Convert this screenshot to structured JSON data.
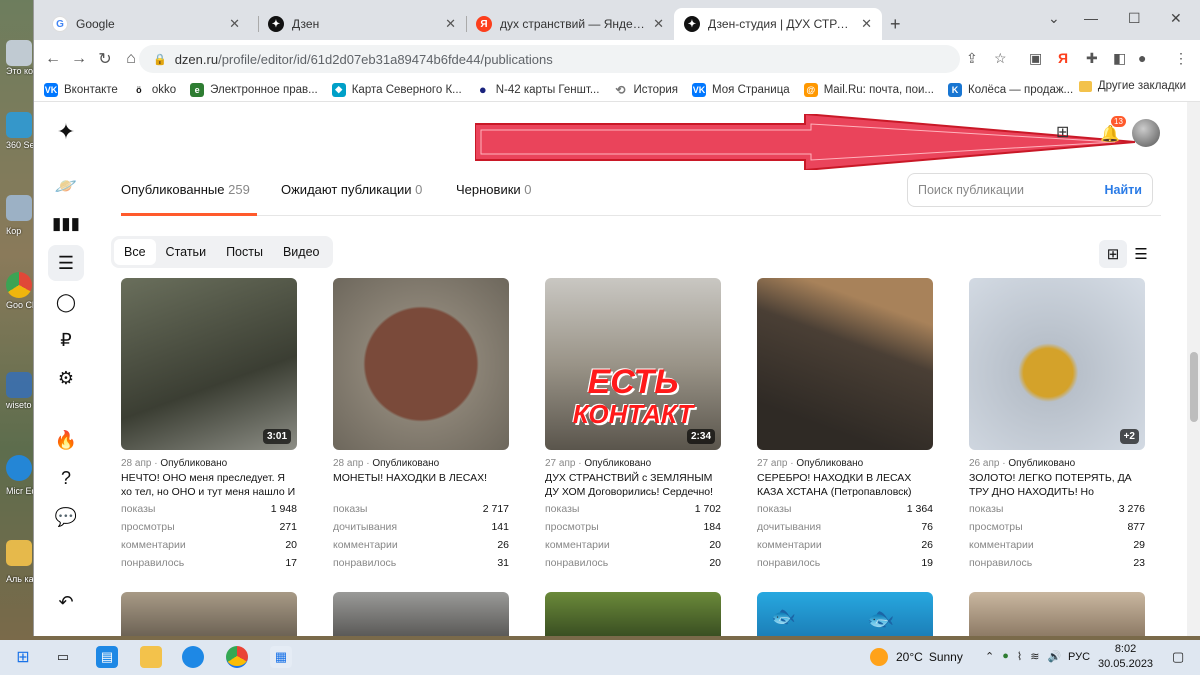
{
  "desktop": {
    "labels": [
      "Это комп",
      "360 Sec",
      "Кор",
      "Goo Chr",
      "wiseto",
      "Micr Ed",
      "Аль кам"
    ]
  },
  "browser": {
    "tabs": [
      {
        "title": "Google",
        "favicon": "G",
        "color": "#4285f4"
      },
      {
        "title": "Дзен",
        "favicon": "✦",
        "color": "#111111"
      },
      {
        "title": "дух странствий — Яндекс: нашё",
        "favicon": "Я",
        "color": "#fc3f1d"
      },
      {
        "title": "Дзен-студия | ДУХ СТРАНСТВИ",
        "favicon": "✦",
        "color": "#111111",
        "active": true
      }
    ],
    "url_host": "dzen.ru",
    "url_path": "/profile/editor/id/61d2d07eb31a89474b6fde44/publications",
    "bookmarks": [
      {
        "label": "Вконтакте",
        "icon": "VK",
        "color": "#0077ff"
      },
      {
        "label": "okko",
        "icon": "ö",
        "color": "#111111"
      },
      {
        "label": "Электронное прав...",
        "icon": "e",
        "color": "#2e7d32"
      },
      {
        "label": "Карта Северного К...",
        "icon": "◆",
        "color": "#00a0c8"
      },
      {
        "label": "N-42 карты Геншт...",
        "icon": "●",
        "color": "#1a237e"
      },
      {
        "label": "История",
        "icon": "⟲",
        "color": "#777777"
      },
      {
        "label": "Моя Страница",
        "icon": "VK",
        "color": "#0077ff"
      },
      {
        "label": "Mail.Ru: почта, пои...",
        "icon": "@",
        "color": "#ff9800"
      },
      {
        "label": "Колёса — продаж...",
        "icon": "K",
        "color": "#1976d2"
      }
    ],
    "other_bookmarks": "Другие закладки"
  },
  "header": {
    "notifications_count": "13"
  },
  "publications": {
    "tabs": [
      {
        "label": "Опубликованные",
        "count": "259",
        "selected": true
      },
      {
        "label": "Ожидают публикации",
        "count": "0"
      },
      {
        "label": "Черновики",
        "count": "0"
      }
    ],
    "search_placeholder": "Поиск публикации",
    "search_button": "Найти",
    "filters": [
      "Все",
      "Статьи",
      "Посты",
      "Видео"
    ]
  },
  "cards": [
    {
      "date": "28 апр",
      "status": "Опубликовано",
      "badge": "3:01",
      "title": "НЕЧТО! ОНО меня преследует. Я хо тел, но ОНО и тут меня нашло И в...",
      "stats": [
        [
          "показы",
          "1 948"
        ],
        [
          "просмотры",
          "271"
        ],
        [
          "комментарии",
          "20"
        ],
        [
          "понравилось",
          "17"
        ]
      ],
      "thumb": "#4b5040"
    },
    {
      "date": "28 апр",
      "status": "Опубликовано",
      "badge": "",
      "title": "МОНЕТЫ! НАХОДКИ В ЛЕСАХ!",
      "stats": [
        [
          "показы",
          "2 717"
        ],
        [
          "дочитывания",
          "141"
        ],
        [
          "комментарии",
          "26"
        ],
        [
          "понравилось",
          "31"
        ]
      ],
      "thumb": "#7a4a38"
    },
    {
      "date": "27 апр",
      "status": "Опубликовано",
      "badge": "2:34",
      "title": "ДУХ СТРАНСТВИЙ с ЗЕМЛЯНЫМ ДУ ХОМ Договорились! Сердечно! (С...",
      "stats": [
        [
          "показы",
          "1 702"
        ],
        [
          "просмотры",
          "184"
        ],
        [
          "комментарии",
          "20"
        ],
        [
          "понравилось",
          "20"
        ]
      ],
      "thumb": "#9a9488",
      "overlay": [
        "ЕСТЬ",
        "КОНТАКТ"
      ]
    },
    {
      "date": "27 апр",
      "status": "Опубликовано",
      "badge": "",
      "title": "СЕРЕБРО! НАХОДКИ В ЛЕСАХ КАЗА ХСТАНА (Петропавловск) ДУХ СТР...",
      "stats": [
        [
          "показы",
          "1 364"
        ],
        [
          "дочитывания",
          "76"
        ],
        [
          "комментарии",
          "26"
        ],
        [
          "понравилось",
          "19"
        ]
      ],
      "thumb": "#4a3f35"
    },
    {
      "date": "26 апр",
      "status": "Опубликовано",
      "badge": "+2",
      "title": "ЗОЛОТО! ЛЕГКО ПОТЕРЯТЬ, ДА ТРУ ДНО НАХОДИТЬ! Но возможно, е...",
      "stats": [
        [
          "показы",
          "3 276"
        ],
        [
          "просмотры",
          "877"
        ],
        [
          "комментарии",
          "29"
        ],
        [
          "понравилось",
          "23"
        ]
      ],
      "thumb": "#c8cfd8"
    }
  ],
  "taskbar": {
    "weather_temp": "20°C",
    "weather_text": "Sunny",
    "language": "РУС",
    "time": "8:02",
    "date": "30.05.2023"
  }
}
